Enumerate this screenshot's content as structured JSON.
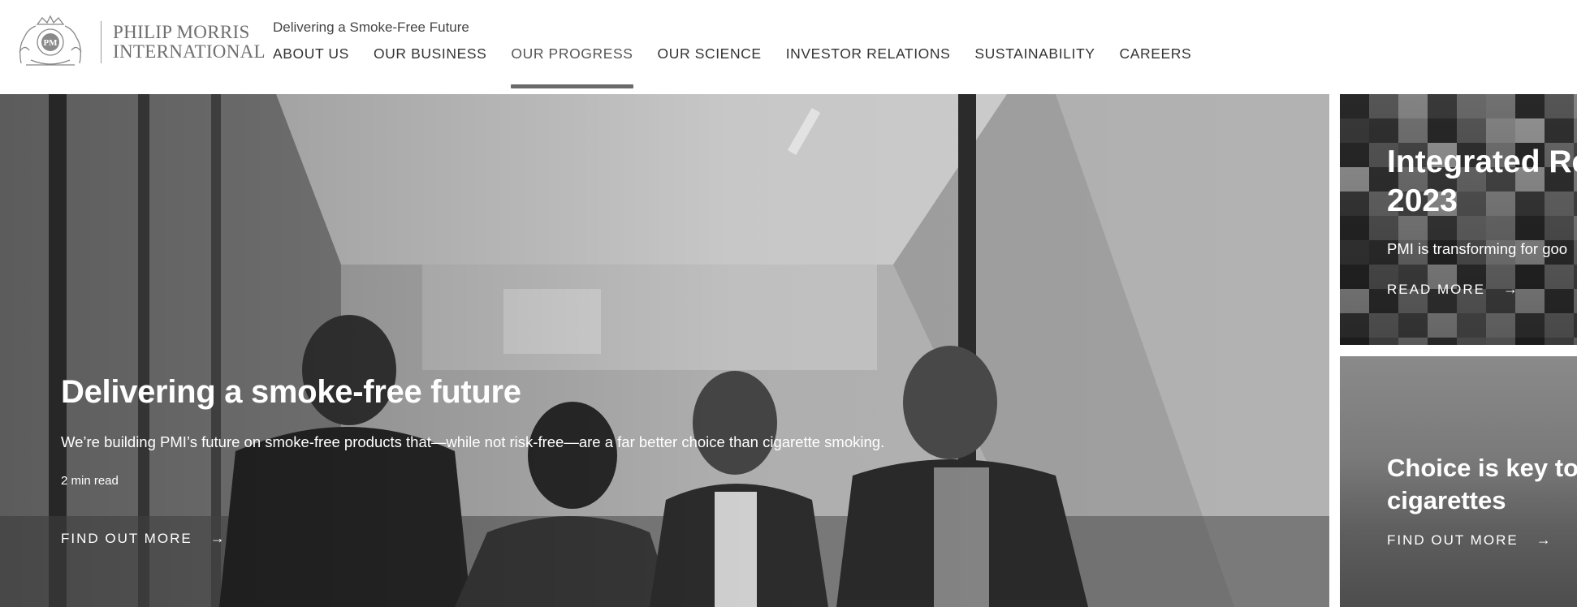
{
  "brand": {
    "name_line1": "PHILIP MORRIS",
    "name_line2": "INTERNATIONAL",
    "tagline": "Delivering a Smoke-Free Future"
  },
  "nav": {
    "items": [
      {
        "label": "ABOUT US"
      },
      {
        "label": "OUR BUSINESS"
      },
      {
        "label": "OUR PROGRESS",
        "active": true
      },
      {
        "label": "OUR SCIENCE"
      },
      {
        "label": "INVESTOR RELATIONS"
      },
      {
        "label": "SUSTAINABILITY"
      },
      {
        "label": "CAREERS"
      }
    ]
  },
  "hero": {
    "title": "Delivering a smoke-free future",
    "description": "We’re building PMI’s future on smoke-free products that—while not risk-free—are a far better choice than cigarette smoking.",
    "read_time": "2 min read",
    "cta_label": "FIND OUT MORE",
    "cta_icon": "arrow-right-icon"
  },
  "cards": [
    {
      "title_line1": "Integrated Re",
      "title_line2": "2023",
      "description": "PMI is transforming for goo",
      "cta_label": "READ MORE",
      "cta_icon": "arrow-right-icon"
    },
    {
      "title_line1": "Choice is key to h",
      "title_line2": "cigarettes",
      "cta_label": "FIND OUT MORE",
      "cta_icon": "arrow-right-icon"
    }
  ],
  "colors": {
    "nav_active_underline": "#6a6a6a",
    "header_bg": "#ffffff",
    "overlay_text": "#ffffff"
  }
}
